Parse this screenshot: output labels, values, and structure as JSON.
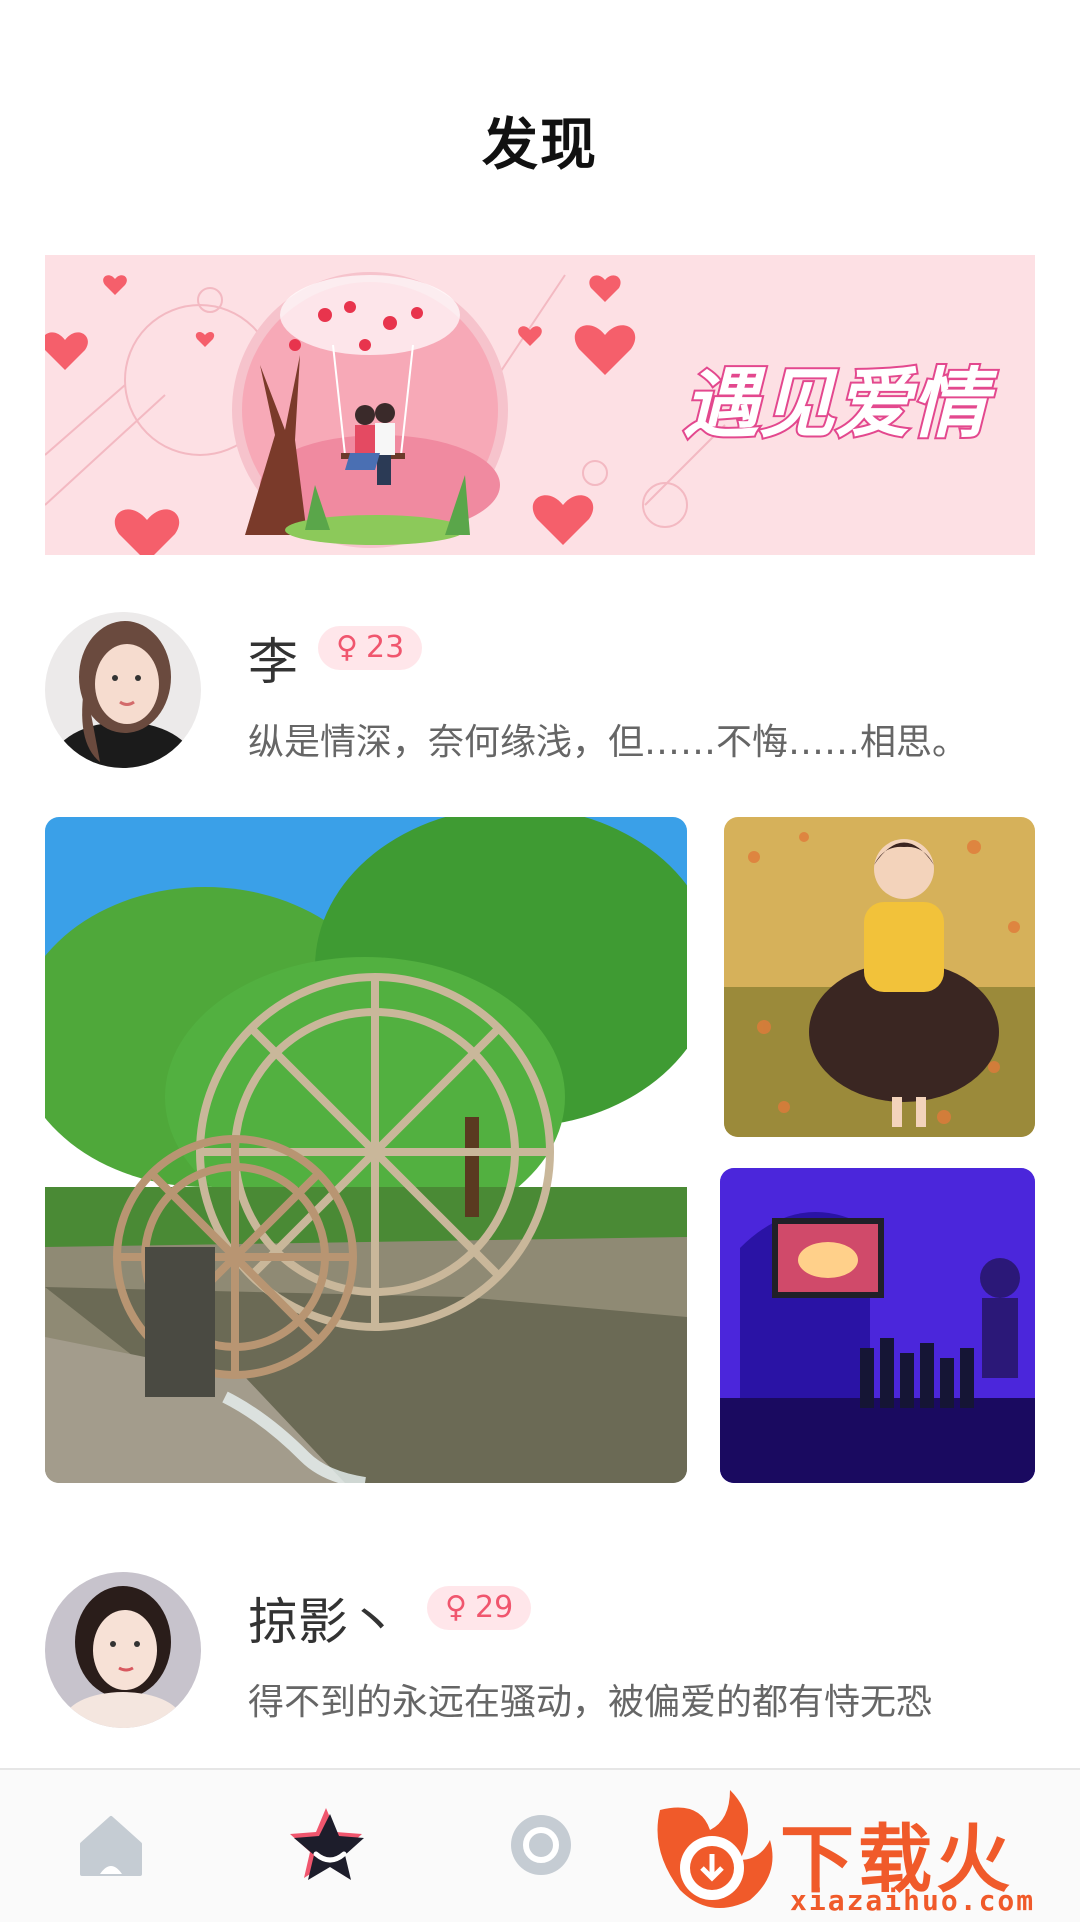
{
  "header": {
    "title": "发现"
  },
  "banner": {
    "text": "遇见爱情"
  },
  "posts": [
    {
      "name": "李",
      "gender_symbol": "♀",
      "age": "23",
      "bio": "纵是情深，奈何缘浅，但……不悔……相思。"
    },
    {
      "name": "掠影丶",
      "gender_symbol": "♀",
      "age": "29",
      "bio": "得不到的永远在骚动，被偏爱的都有恃无恐"
    }
  ],
  "tabbar": {
    "items": [
      {
        "icon": "home-icon",
        "active": false
      },
      {
        "icon": "star-icon",
        "active": true
      },
      {
        "icon": "circle-icon",
        "active": false
      },
      {
        "icon": "profile-icon",
        "active": false
      }
    ]
  },
  "watermark": {
    "text": "下载火",
    "url": "xiazaihuo.com"
  },
  "colors": {
    "accent": "#f0566e",
    "badge_bg": "#ffe6ea",
    "banner_bg": "#fde0e4",
    "watermark": "#f05a2a"
  }
}
